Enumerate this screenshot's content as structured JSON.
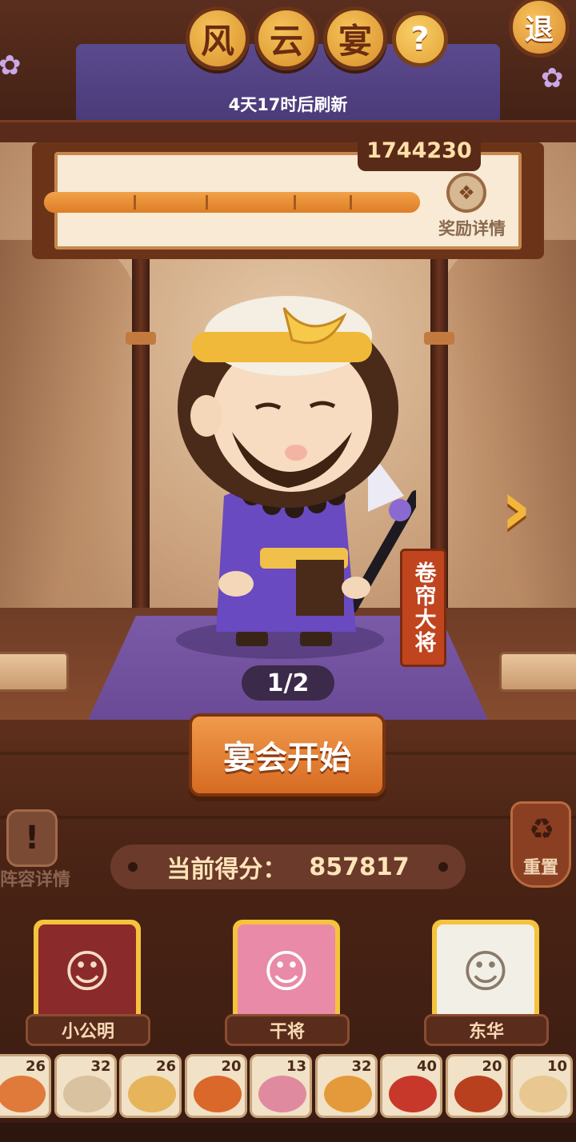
{
  "header": {
    "title_chars": [
      "风",
      "云",
      "宴"
    ],
    "help_icon": "question-mark-icon",
    "exit_label": "退",
    "refresh_text": "4天17时后刷新"
  },
  "progress": {
    "target_score": "1744230",
    "fill_fraction": 1.0,
    "reward_label": "奖励详情",
    "reward_icon": "reward-bag-icon"
  },
  "character": {
    "name": "卷帘大将",
    "page_indicator": "1/2"
  },
  "actions": {
    "start_label": "宴会开始",
    "lineup_label": "阵容详情",
    "reset_label": "重置"
  },
  "score": {
    "label": "当前得分：",
    "value": "857817"
  },
  "heroes": [
    {
      "name": "小公明",
      "color": "#8a2a2a"
    },
    {
      "name": "干将",
      "color": "#e88aa8"
    },
    {
      "name": "东华",
      "color": "#f2efe6"
    }
  ],
  "dishes": [
    {
      "count": "26",
      "color": "#e07a3a"
    },
    {
      "count": "32",
      "color": "#d9c2a0"
    },
    {
      "count": "26",
      "color": "#e6b45a"
    },
    {
      "count": "20",
      "color": "#d9682a"
    },
    {
      "count": "13",
      "color": "#e08aa0"
    },
    {
      "count": "32",
      "color": "#e49a3a"
    },
    {
      "count": "40",
      "color": "#c8382a"
    },
    {
      "count": "20",
      "color": "#b8401e"
    },
    {
      "count": "10",
      "color": "#e8c890"
    }
  ],
  "colors": {
    "accent": "#d66b22",
    "gold": "#f5c33c",
    "purple": "#6a4a96"
  }
}
